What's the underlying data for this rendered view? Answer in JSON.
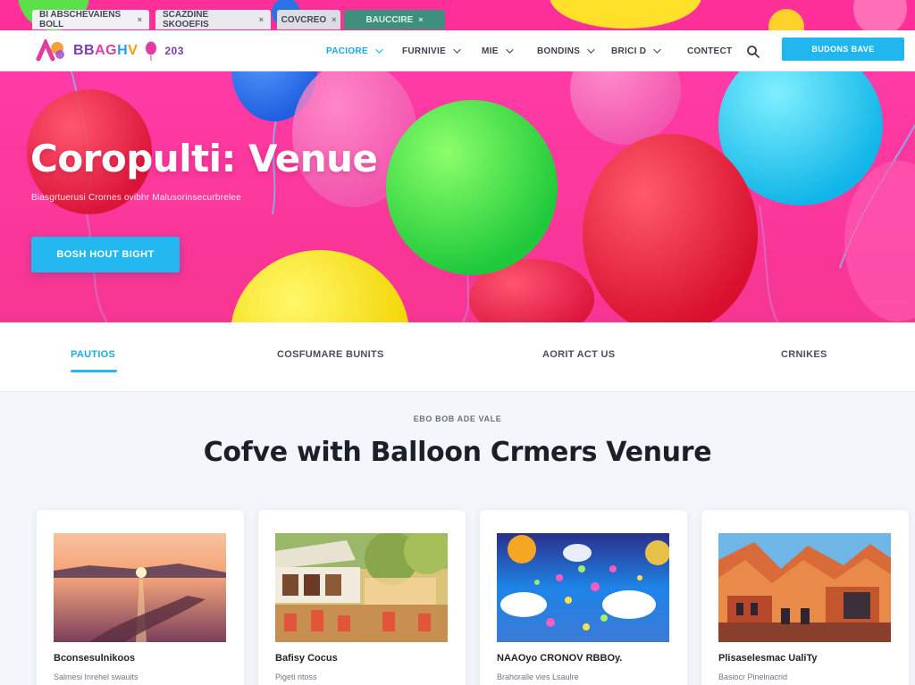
{
  "browser_tabs": [
    {
      "label": "BI ABSCHEVAIENS BOLL",
      "close": "×"
    },
    {
      "label": "SCAZDINE SKOOEFIS",
      "close": "×"
    },
    {
      "label": "COVCREO",
      "close": "×"
    },
    {
      "label": "BAUCCIRE",
      "close": "×"
    }
  ],
  "header": {
    "logo_parts": [
      "BB",
      "AG",
      "H",
      "V"
    ],
    "logo_suffix": "203",
    "nav": [
      {
        "label": "PACIORE",
        "has_chevron": true,
        "active": true
      },
      {
        "label": "FURNIVIE",
        "has_chevron": true,
        "active": false
      },
      {
        "label": "MIE",
        "has_chevron": true,
        "active": false
      },
      {
        "label": "BONDINS",
        "has_chevron": true,
        "active": false
      },
      {
        "label": "BRICI D",
        "has_chevron": true,
        "active": false
      },
      {
        "label": "CONTECT",
        "has_chevron": false,
        "active": false
      }
    ],
    "search_icon": "search-icon",
    "cta_label": "BUDONS BAVE"
  },
  "hero": {
    "title": "Coropulti: Venue",
    "subtitle": "Biasgrtuerusi Crornes ovibhr Malusorinsecurbrelee",
    "button_label": "BOSH HOUT BIGHT"
  },
  "subtabs": [
    {
      "label": "PAUTIOS",
      "active": true
    },
    {
      "label": "COSFUMARE BUNITS",
      "active": false
    },
    {
      "label": "AORIT ACT US",
      "active": false
    },
    {
      "label": "CRNIKES",
      "active": false
    }
  ],
  "section": {
    "eyebrow": "EBO BOB ADE VALE",
    "title": "Cofve with Balloon Crmers Venure"
  },
  "cards": [
    {
      "title": "Bconsesulnikoos",
      "meta": "Salmesi Inrehel swauits"
    },
    {
      "title": "Bafisy Cocus",
      "meta": "Pigeti ritoss"
    },
    {
      "title": "NAAOyo CRONOV RBBOy.",
      "meta": "Brahoralle vies Lsaulre"
    },
    {
      "title": "Plisaselesmac UaliTy",
      "meta": "Basiocr Pinelnacrid"
    }
  ],
  "colors": {
    "brand_pink": "#ff3aa6",
    "accent_blue": "#22b6ee",
    "text_dark": "#1b1f27"
  }
}
